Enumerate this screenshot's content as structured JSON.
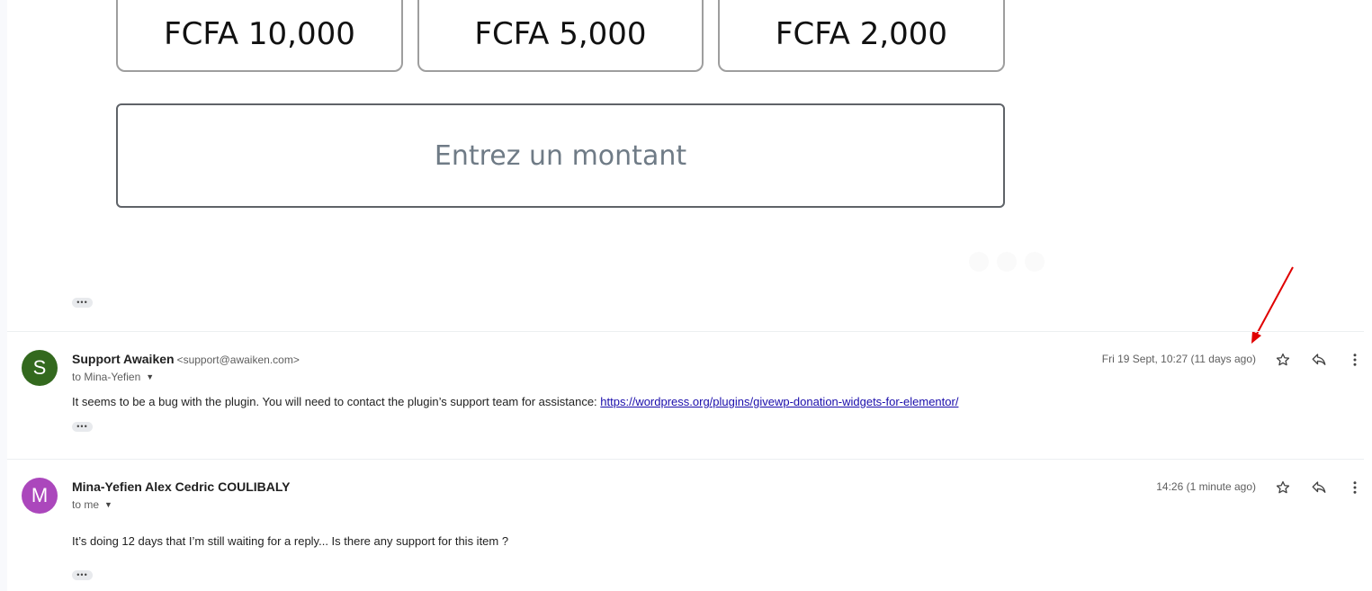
{
  "donation_widget": {
    "amounts": [
      "FCFA 10,000",
      "FCFA 5,000",
      "FCFA 2,000"
    ],
    "custom_amount_label": "Entrez un montant"
  },
  "messages": [
    {
      "avatar_letter": "S",
      "avatar_color": "#33691e",
      "sender_name": "Support Awaiken",
      "sender_email": "<support@awaiken.com>",
      "recipient": "to Mina-Yefien",
      "timestamp": "Fri 19 Sept, 10:27 (11 days ago)",
      "body_text": "It seems to be a bug with the plugin. You will need to contact the plugin’s support team for assistance: ",
      "body_link": "https://wordpress.org/plugins/givewp-donation-widgets-for-elementor/"
    },
    {
      "avatar_letter": "M",
      "avatar_color": "#ab47bc",
      "sender_name": "Mina-Yefien Alex Cedric COULIBALY",
      "recipient": "to me",
      "timestamp": "14:26 (1 minute ago)",
      "body_text": "It’s doing 12 days that I’m still waiting for a reply... Is there any support for this item ?"
    }
  ],
  "ui": {
    "ellipsis_label": "•••",
    "caret": "▼"
  },
  "icons": {
    "star": "star-icon",
    "reply": "reply-icon",
    "more": "more-vert-icon"
  },
  "colors": {
    "link": "#1a0dab",
    "annotation_arrow": "#e00000"
  }
}
